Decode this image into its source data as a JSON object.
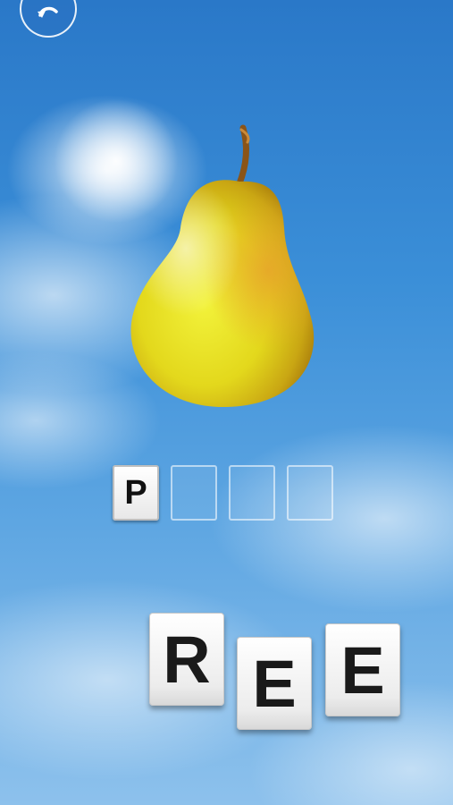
{
  "navigation": {
    "back_icon": "undo-arrow-icon"
  },
  "picture": {
    "subject_icon": "pear-icon"
  },
  "answer_slots": [
    {
      "letter": "P"
    },
    {
      "letter": ""
    },
    {
      "letter": ""
    },
    {
      "letter": ""
    }
  ],
  "letter_tiles": [
    {
      "letter": "R"
    },
    {
      "letter": "E"
    },
    {
      "letter": "E"
    }
  ],
  "colors": {
    "sky": "#3b8fd8",
    "pear": "#e6e020",
    "tile": "#ffffff"
  }
}
